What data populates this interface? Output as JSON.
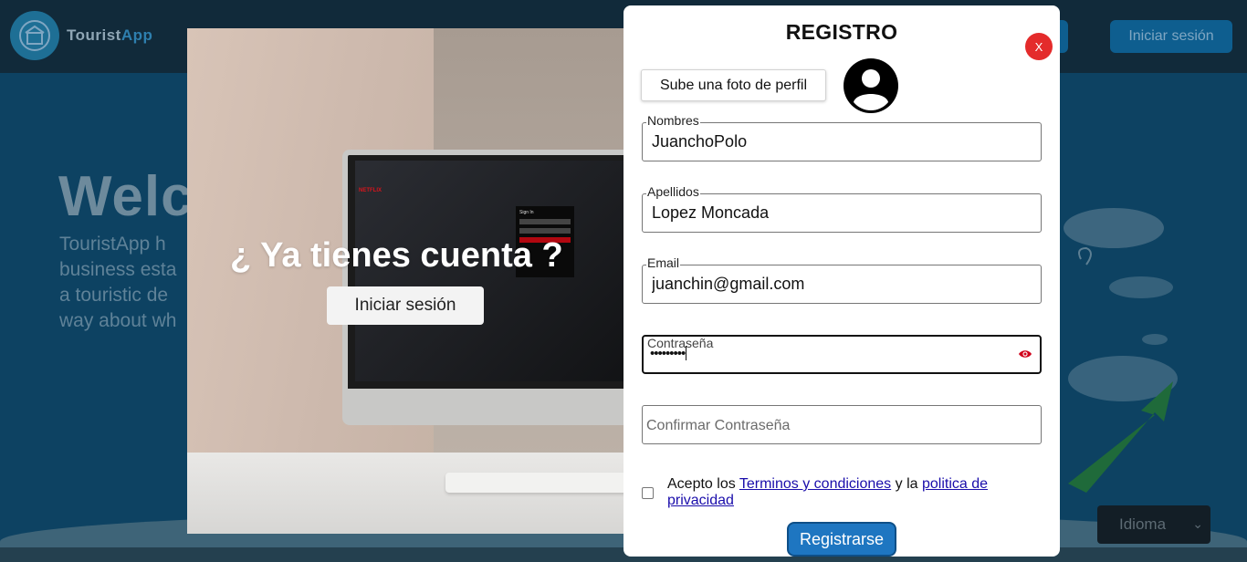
{
  "background": {
    "logo_text_main": "Tourist",
    "logo_text_accent": "App",
    "nav_login_label": "Iniciar sesión",
    "hero_heading_visible": "Welc",
    "hero_text_lines": [
      "TouristApp h",
      "business esta",
      "a touristic de",
      "way about wh"
    ],
    "language_select_value": "Idioma",
    "colors": {
      "background": "#0d4262",
      "topbar": "#112a3a",
      "nav_button": "#0e5e8f"
    }
  },
  "photo_panel": {
    "title": "¿ Ya tienes cuenta ?",
    "login_button": "Iniciar sesión"
  },
  "modal": {
    "title": "REGISTRO",
    "close_label": "X",
    "upload_photo_button": "Sube una foto de perfil",
    "avatar_icon": "user-avatar-icon",
    "fields": {
      "nombres": {
        "label": "Nombres",
        "value": "JuanchoPolo"
      },
      "apellidos": {
        "label": "Apellidos",
        "value": "Lopez Moncada"
      },
      "email": {
        "label": "Email",
        "value": "juanchin@gmail.com"
      },
      "password": {
        "label": "Contraseña",
        "value": "•••••••••",
        "icon": "eye-icon"
      },
      "confirm_password": {
        "placeholder": "Confirmar Contraseña",
        "value": ""
      }
    },
    "terms": {
      "prefix": "Acepto los ",
      "terms_link": "Terminos y condiciones",
      "middle": " y la ",
      "privacy_link": "politica de privacidad",
      "checked": false
    },
    "register_button": "Registrarse",
    "colors": {
      "close": "#e42b2b",
      "register": "#1e76c1",
      "link": "#1a0dab",
      "eye": "#d0021b"
    }
  }
}
